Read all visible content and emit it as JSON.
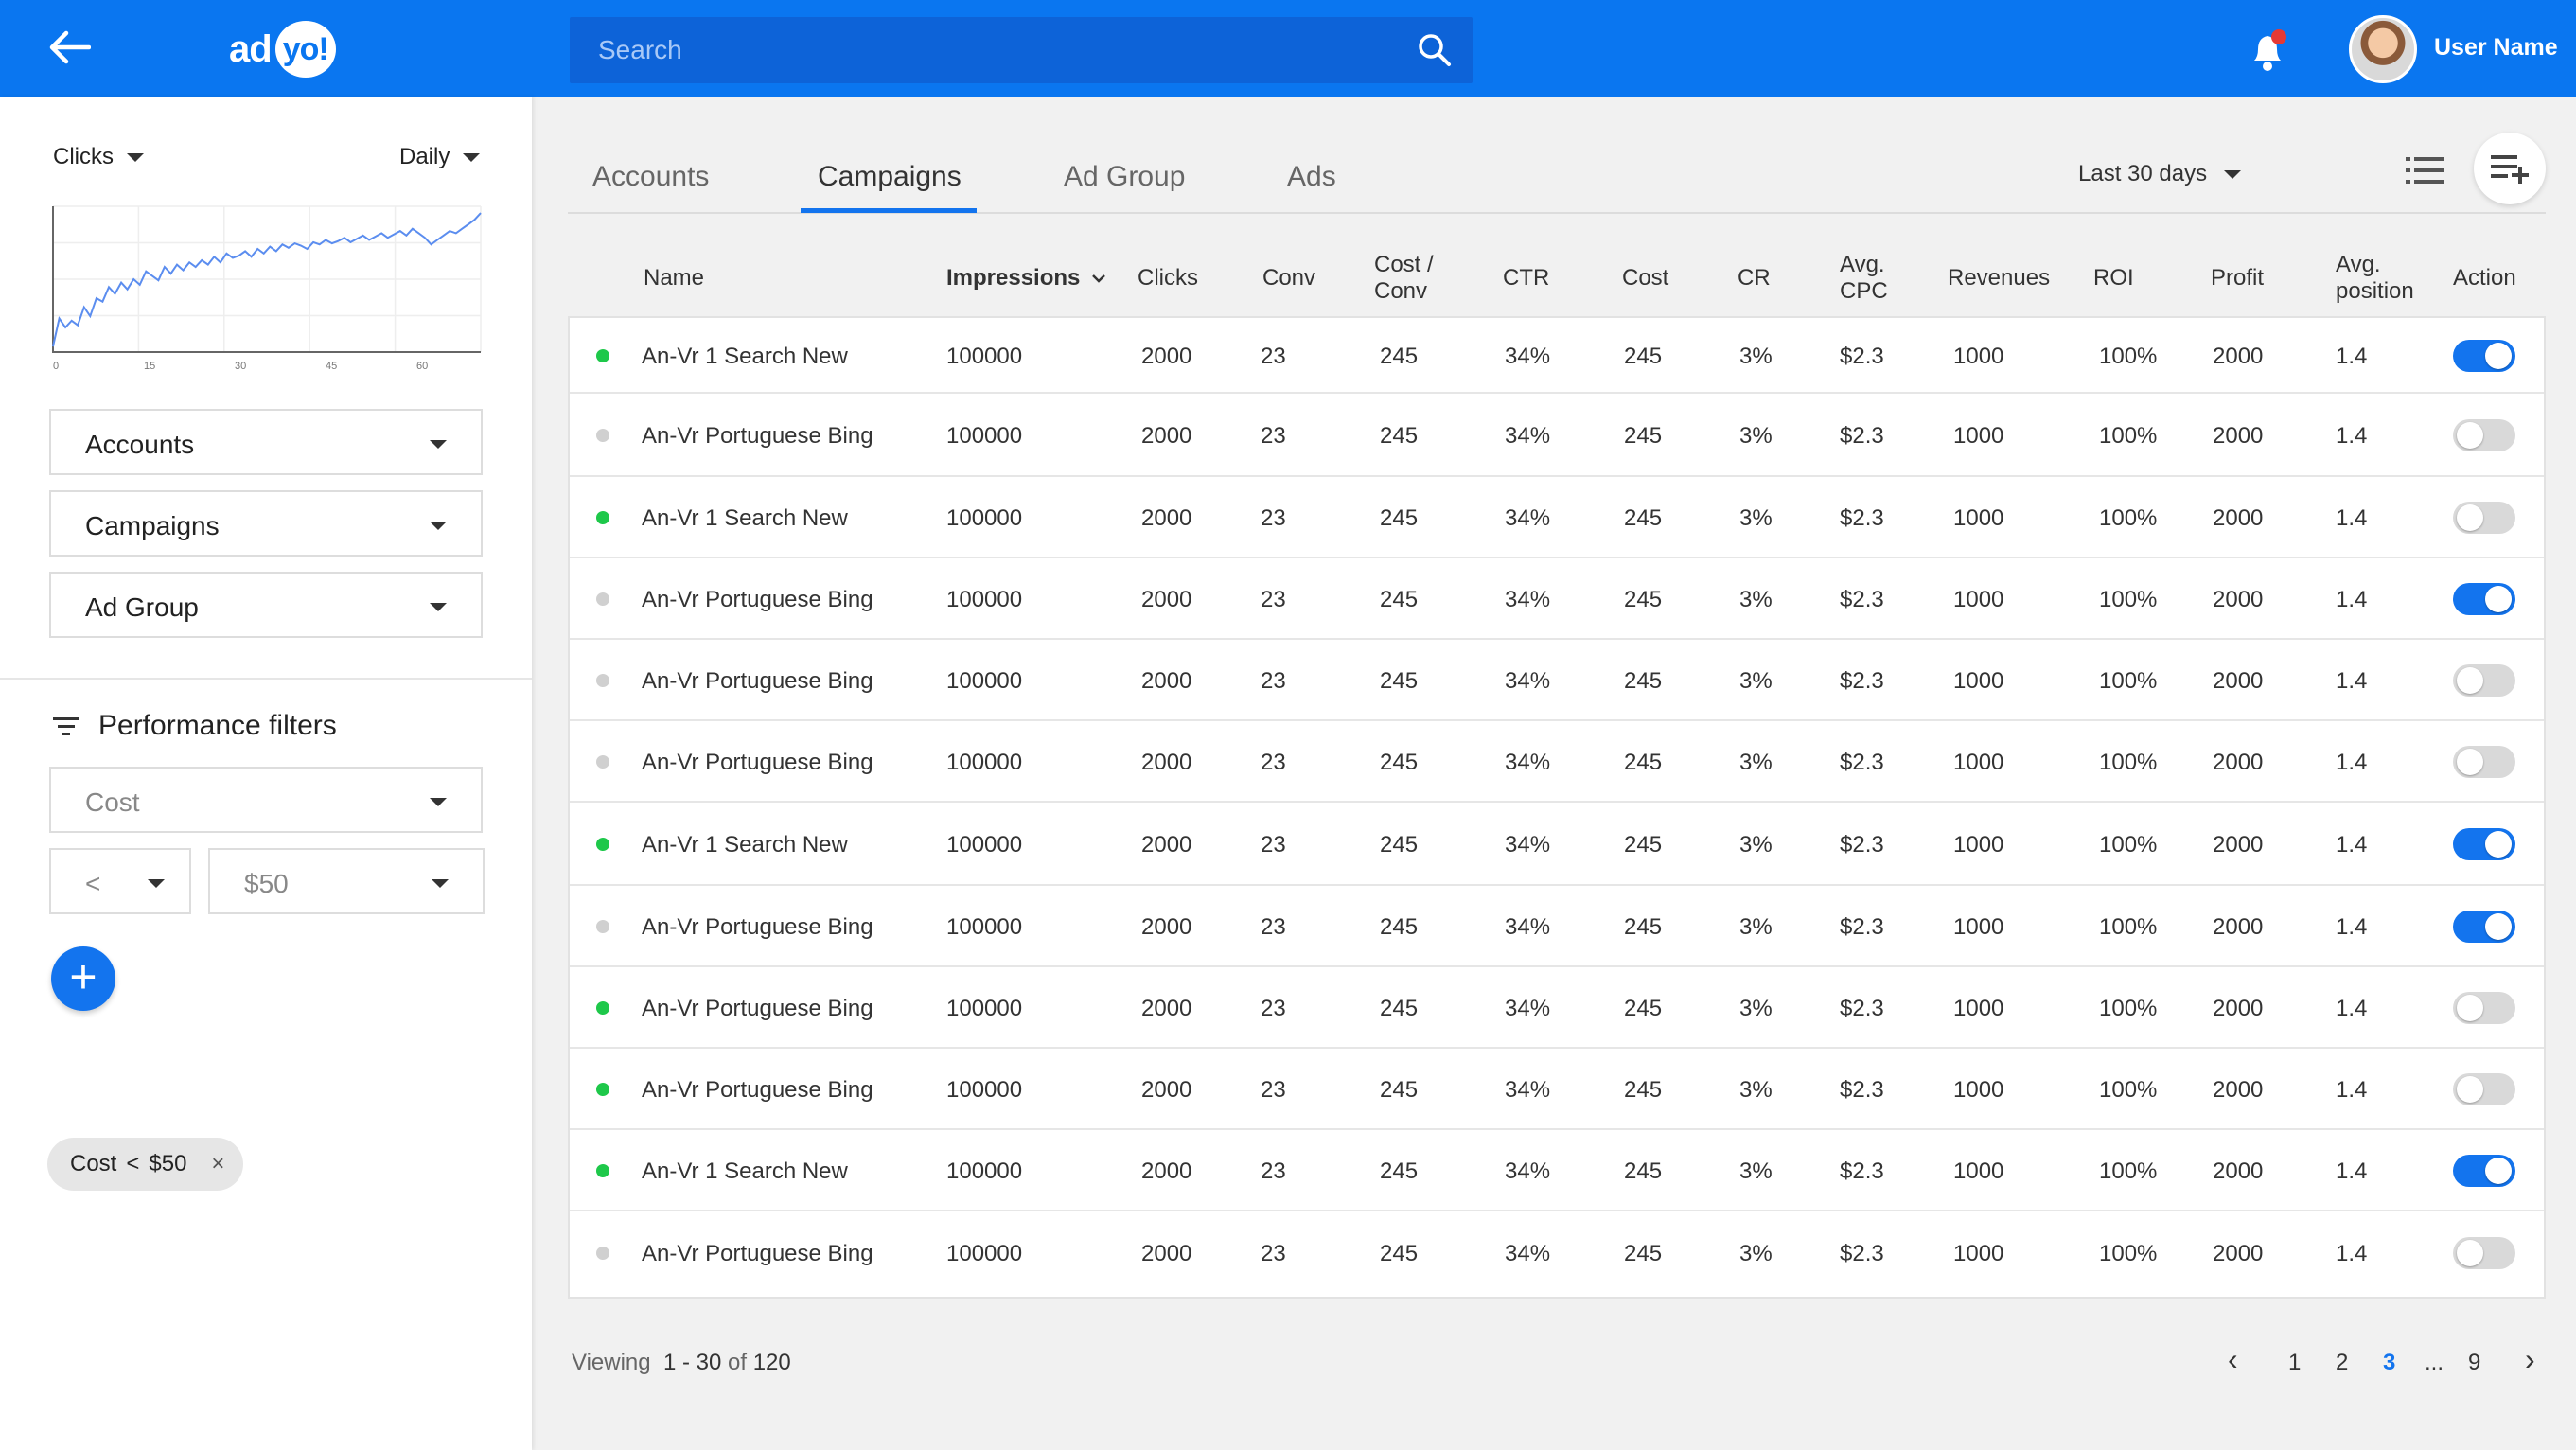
{
  "topbar": {
    "logo_ad": "ad",
    "logo_yo": "yo!",
    "search_placeholder": "Search",
    "user_name": "User Name",
    "colors": {
      "primary": "#0a76f0",
      "search_bg": "#0d63d8",
      "notification": "#e53935"
    }
  },
  "sidebar": {
    "metric": "Clicks",
    "interval": "Daily",
    "chart_data": {
      "type": "line",
      "x": [
        0,
        1,
        2,
        3,
        4,
        5,
        6,
        7,
        8,
        9,
        10,
        11,
        12,
        13,
        14,
        15,
        16,
        17,
        18,
        19,
        20,
        21,
        22,
        23,
        24,
        25,
        26,
        27,
        28,
        29,
        30,
        31,
        32,
        33,
        34,
        35,
        36,
        37,
        38,
        39,
        40,
        41,
        42,
        43,
        44,
        45,
        46,
        47,
        48,
        49,
        50,
        51,
        52,
        53,
        54,
        55,
        56,
        57,
        58,
        59,
        60,
        61,
        62,
        63,
        64,
        65,
        66,
        67,
        68,
        69
      ],
      "values": [
        5,
        30,
        22,
        28,
        24,
        40,
        32,
        48,
        45,
        58,
        52,
        62,
        56,
        65,
        60,
        72,
        68,
        64,
        76,
        70,
        78,
        73,
        80,
        76,
        82,
        78,
        85,
        80,
        88,
        84,
        86,
        90,
        85,
        92,
        88,
        94,
        90,
        96,
        93,
        97,
        95,
        92,
        98,
        96,
        100,
        97,
        99,
        102,
        98,
        101,
        104,
        100,
        103,
        106,
        102,
        105,
        108,
        104,
        110,
        106,
        102,
        96,
        100,
        104,
        108,
        106,
        110,
        114,
        118,
        124
      ],
      "xticks": [
        "0",
        "15",
        "30",
        "45",
        "60"
      ],
      "grid": true,
      "color": "#5b8def"
    },
    "selects": {
      "accounts": "Accounts",
      "campaigns": "Campaigns",
      "ad_group": "Ad Group"
    },
    "performance_filters": {
      "title": "Performance filters",
      "field": "Cost",
      "operator": "<",
      "value": "$50",
      "chip": {
        "field": "Cost",
        "operator": "<",
        "value": "$50",
        "close": "×"
      }
    },
    "add_label": "+"
  },
  "main": {
    "tabs": [
      {
        "label": "Accounts",
        "active": false
      },
      {
        "label": "Campaigns",
        "active": true
      },
      {
        "label": "Ad Group",
        "active": false
      },
      {
        "label": "Ads",
        "active": false
      }
    ],
    "date_range": "Last 30 days",
    "columns": {
      "name": "Name",
      "impressions": "Impressions",
      "clicks": "Clicks",
      "conv": "Conv",
      "cost_conv_1": "Cost /",
      "cost_conv_2": "Conv",
      "ctr": "CTR",
      "cost": "Cost",
      "cr": "CR",
      "avg_cpc_1": "Avg.",
      "avg_cpc_2": "CPC",
      "revenues": "Revenues",
      "roi": "ROI",
      "profit": "Profit",
      "avg_pos_1": "Avg.",
      "avg_pos_2": "position",
      "action": "Action"
    },
    "rows": [
      {
        "name": "An-Vr 1 Search New",
        "status": "active",
        "impressions": "100000",
        "clicks": "2000",
        "conv": "23",
        "cost_conv": "245",
        "ctr": "34%",
        "cost": "245",
        "cr": "3%",
        "avg_cpc": "$2.3",
        "revenues": "1000",
        "roi": "100%",
        "profit": "2000",
        "avg_position": "1.4",
        "enabled": true
      },
      {
        "name": "An-Vr Portuguese Bing",
        "status": "inactive",
        "impressions": "100000",
        "clicks": "2000",
        "conv": "23",
        "cost_conv": "245",
        "ctr": "34%",
        "cost": "245",
        "cr": "3%",
        "avg_cpc": "$2.3",
        "revenues": "1000",
        "roi": "100%",
        "profit": "2000",
        "avg_position": "1.4",
        "enabled": false
      },
      {
        "name": "An-Vr 1 Search New",
        "status": "active",
        "impressions": "100000",
        "clicks": "2000",
        "conv": "23",
        "cost_conv": "245",
        "ctr": "34%",
        "cost": "245",
        "cr": "3%",
        "avg_cpc": "$2.3",
        "revenues": "1000",
        "roi": "100%",
        "profit": "2000",
        "avg_position": "1.4",
        "enabled": false
      },
      {
        "name": "An-Vr Portuguese Bing",
        "status": "inactive",
        "impressions": "100000",
        "clicks": "2000",
        "conv": "23",
        "cost_conv": "245",
        "ctr": "34%",
        "cost": "245",
        "cr": "3%",
        "avg_cpc": "$2.3",
        "revenues": "1000",
        "roi": "100%",
        "profit": "2000",
        "avg_position": "1.4",
        "enabled": true
      },
      {
        "name": "An-Vr Portuguese Bing",
        "status": "inactive",
        "impressions": "100000",
        "clicks": "2000",
        "conv": "23",
        "cost_conv": "245",
        "ctr": "34%",
        "cost": "245",
        "cr": "3%",
        "avg_cpc": "$2.3",
        "revenues": "1000",
        "roi": "100%",
        "profit": "2000",
        "avg_position": "1.4",
        "enabled": false
      },
      {
        "name": "An-Vr Portuguese Bing",
        "status": "inactive",
        "impressions": "100000",
        "clicks": "2000",
        "conv": "23",
        "cost_conv": "245",
        "ctr": "34%",
        "cost": "245",
        "cr": "3%",
        "avg_cpc": "$2.3",
        "revenues": "1000",
        "roi": "100%",
        "profit": "2000",
        "avg_position": "1.4",
        "enabled": false
      },
      {
        "name": "An-Vr 1 Search New",
        "status": "active",
        "impressions": "100000",
        "clicks": "2000",
        "conv": "23",
        "cost_conv": "245",
        "ctr": "34%",
        "cost": "245",
        "cr": "3%",
        "avg_cpc": "$2.3",
        "revenues": "1000",
        "roi": "100%",
        "profit": "2000",
        "avg_position": "1.4",
        "enabled": true
      },
      {
        "name": "An-Vr Portuguese Bing",
        "status": "inactive",
        "impressions": "100000",
        "clicks": "2000",
        "conv": "23",
        "cost_conv": "245",
        "ctr": "34%",
        "cost": "245",
        "cr": "3%",
        "avg_cpc": "$2.3",
        "revenues": "1000",
        "roi": "100%",
        "profit": "2000",
        "avg_position": "1.4",
        "enabled": true
      },
      {
        "name": "An-Vr Portuguese Bing",
        "status": "active",
        "impressions": "100000",
        "clicks": "2000",
        "conv": "23",
        "cost_conv": "245",
        "ctr": "34%",
        "cost": "245",
        "cr": "3%",
        "avg_cpc": "$2.3",
        "revenues": "1000",
        "roi": "100%",
        "profit": "2000",
        "avg_position": "1.4",
        "enabled": false
      },
      {
        "name": "An-Vr Portuguese Bing",
        "status": "active",
        "impressions": "100000",
        "clicks": "2000",
        "conv": "23",
        "cost_conv": "245",
        "ctr": "34%",
        "cost": "245",
        "cr": "3%",
        "avg_cpc": "$2.3",
        "revenues": "1000",
        "roi": "100%",
        "profit": "2000",
        "avg_position": "1.4",
        "enabled": false
      },
      {
        "name": "An-Vr 1 Search New",
        "status": "active",
        "impressions": "100000",
        "clicks": "2000",
        "conv": "23",
        "cost_conv": "245",
        "ctr": "34%",
        "cost": "245",
        "cr": "3%",
        "avg_cpc": "$2.3",
        "revenues": "1000",
        "roi": "100%",
        "profit": "2000",
        "avg_position": "1.4",
        "enabled": true
      },
      {
        "name": "An-Vr Portuguese Bing",
        "status": "inactive",
        "impressions": "100000",
        "clicks": "2000",
        "conv": "23",
        "cost_conv": "245",
        "ctr": "34%",
        "cost": "245",
        "cr": "3%",
        "avg_cpc": "$2.3",
        "revenues": "1000",
        "roi": "100%",
        "profit": "2000",
        "avg_position": "1.4",
        "enabled": false
      }
    ],
    "status_colors": {
      "active": "#1ec84a",
      "inactive": "#d0d0d0"
    },
    "toggle_colors": {
      "on": "#1374ee",
      "off": "#d9d9d9"
    },
    "footer": {
      "viewing_label": "Viewing",
      "viewing_range": "1 - 30",
      "viewing_of": "of",
      "viewing_total": "120",
      "pages": [
        "1",
        "2",
        "3",
        "...",
        "9"
      ],
      "current_page": "3",
      "prev": "‹",
      "next": "›"
    }
  }
}
